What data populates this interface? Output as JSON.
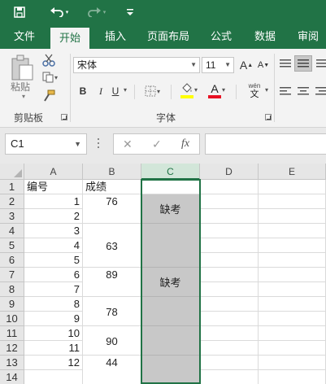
{
  "tabs": [
    "文件",
    "开始",
    "插入",
    "页面布局",
    "公式",
    "数据",
    "审阅"
  ],
  "ribbon": {
    "paste_label": "粘贴",
    "clipboard_group": "剪贴板",
    "font_group": "字体",
    "font_name": "宋体",
    "font_size": "11",
    "bold": "B",
    "italic": "I",
    "underline": "U",
    "grow_font": "A",
    "shrink_font": "A",
    "font_color_letter": "A",
    "phonetic": "wén",
    "phonetic_char": "文"
  },
  "formula_bar": {
    "name_box": "C1",
    "cancel": "✕",
    "enter": "✓",
    "fx": "fx",
    "value": ""
  },
  "columns": [
    "A",
    "B",
    "C",
    "D",
    "E"
  ],
  "rows": [
    "1",
    "2",
    "3",
    "4",
    "5",
    "6",
    "7",
    "8",
    "9",
    "10",
    "11",
    "12",
    "13",
    "14"
  ],
  "sheet": {
    "a": [
      "编号",
      "1",
      "2",
      "3",
      "4",
      "5",
      "6",
      "7",
      "8",
      "9",
      "10",
      "11",
      "12"
    ],
    "b_header": "成绩",
    "b_values": [
      "76",
      "63",
      "89",
      "78",
      "90",
      "44"
    ],
    "c_values": [
      "缺考",
      "缺考"
    ]
  },
  "colors": {
    "accent": "#217346",
    "selection_gray": "#c8c8c8",
    "font_color_bar": "#e81123",
    "highlight_bar": "#ffff00"
  }
}
